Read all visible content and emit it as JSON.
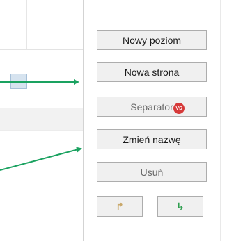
{
  "buttons": {
    "new_level": "Nowy poziom",
    "new_page": "Nowa strona",
    "separator": "Separator",
    "rename": "Zmień nazwę",
    "delete": "Usuń"
  },
  "arrows": {
    "move_up_icon": "curved-arrow-up-icon",
    "move_down_icon": "curved-arrow-down-icon",
    "up_glyph": "↱",
    "down_glyph": "↳"
  },
  "badge": {
    "text": "VS"
  },
  "colors": {
    "callout_arrow": "#1aa260",
    "badge": "#d63a3a",
    "button_face": "#f0f0f0",
    "button_border": "#adadad"
  }
}
